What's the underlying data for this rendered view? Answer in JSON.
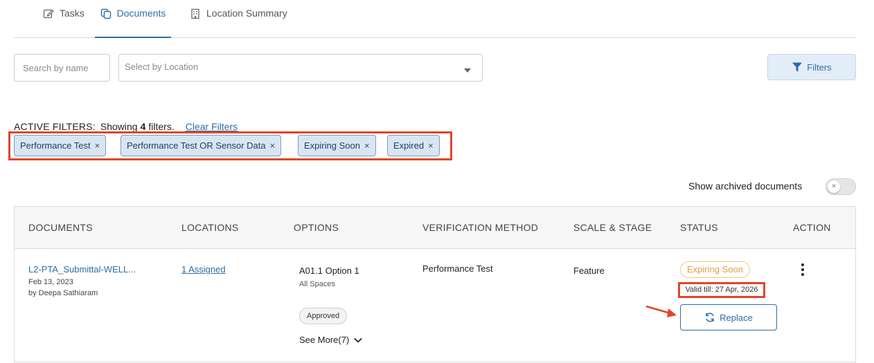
{
  "tabs": [
    {
      "label": "Tasks",
      "icon": "edit-icon"
    },
    {
      "label": "Documents",
      "icon": "copy-icon"
    },
    {
      "label": "Location Summary",
      "icon": "building-icon"
    }
  ],
  "search": {
    "placeholder": "Search by name"
  },
  "location_select": {
    "placeholder": "Select by Location"
  },
  "filters_button": {
    "label": "Filters",
    "icon": "funnel-icon"
  },
  "active_filters": {
    "label": "ACTIVE FILTERS:",
    "showing": "Showing",
    "count": "4",
    "suffix": "filters.",
    "clear_label": "Clear Filters",
    "chips": [
      "Performance Test",
      "Performance Test OR Sensor Data",
      "Expiring Soon",
      "Expired"
    ],
    "remove_glyph": "×"
  },
  "archived": {
    "label": "Show archived documents",
    "enabled": false,
    "knob_glyph": "×"
  },
  "table": {
    "headers": [
      "DOCUMENTS",
      "LOCATIONS",
      "OPTIONS",
      "VERIFICATION METHOD",
      "SCALE & STAGE",
      "STATUS",
      "ACTION"
    ],
    "rows": [
      {
        "document": "L2-PTA_Submittal-WELL...",
        "date": "Feb 13, 2023",
        "by": "by Deepa Sathiaram",
        "locations": "1 Assigned",
        "option_name": "A01.1 Option 1",
        "option_sub": "All Spaces",
        "option_badge": "Approved",
        "see_more": "See More(7)",
        "verification": "Performance Test",
        "scale": "Feature",
        "status": "Expiring Soon",
        "valid_till": "Valid till: 27 Apr, 2026",
        "replace_label": "Replace"
      }
    ]
  },
  "colors": {
    "accent": "#2e6da4",
    "highlight": "#e2452a",
    "warning": "#e0a040"
  }
}
